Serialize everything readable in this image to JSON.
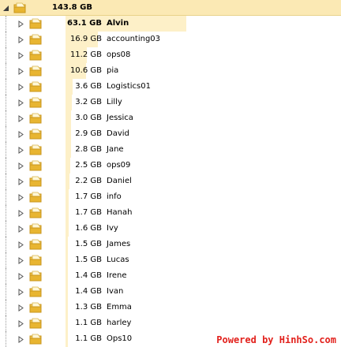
{
  "root": {
    "size": "143.8 GB"
  },
  "folders": [
    {
      "size": "63.1 GB",
      "name": "Alvin",
      "share": 0.439,
      "bold": true
    },
    {
      "size": "16.9 GB",
      "name": "accounting03",
      "share": 0.118,
      "bold": false
    },
    {
      "size": "11.2 GB",
      "name": "ops08",
      "share": 0.078,
      "bold": false
    },
    {
      "size": "10.6 GB",
      "name": "pia",
      "share": 0.074,
      "bold": false
    },
    {
      "size": "3.6 GB",
      "name": "Logistics01",
      "share": 0.025,
      "bold": false
    },
    {
      "size": "3.2 GB",
      "name": "Lilly",
      "share": 0.022,
      "bold": false
    },
    {
      "size": "3.0 GB",
      "name": "Jessica",
      "share": 0.021,
      "bold": false
    },
    {
      "size": "2.9 GB",
      "name": "David",
      "share": 0.02,
      "bold": false
    },
    {
      "size": "2.8 GB",
      "name": "Jane",
      "share": 0.019,
      "bold": false
    },
    {
      "size": "2.5 GB",
      "name": "ops09",
      "share": 0.017,
      "bold": false
    },
    {
      "size": "2.2 GB",
      "name": "Daniel",
      "share": 0.015,
      "bold": false
    },
    {
      "size": "1.7 GB",
      "name": "info",
      "share": 0.012,
      "bold": false
    },
    {
      "size": "1.7 GB",
      "name": "Hanah",
      "share": 0.012,
      "bold": false
    },
    {
      "size": "1.6 GB",
      "name": "Ivy",
      "share": 0.011,
      "bold": false
    },
    {
      "size": "1.5 GB",
      "name": "James",
      "share": 0.01,
      "bold": false
    },
    {
      "size": "1.5 GB",
      "name": "Lucas",
      "share": 0.01,
      "bold": false
    },
    {
      "size": "1.4 GB",
      "name": "Irene",
      "share": 0.01,
      "bold": false
    },
    {
      "size": "1.4 GB",
      "name": "Ivan",
      "share": 0.01,
      "bold": false
    },
    {
      "size": "1.3 GB",
      "name": "Emma",
      "share": 0.009,
      "bold": false
    },
    {
      "size": "1.1 GB",
      "name": "harley",
      "share": 0.008,
      "bold": false
    },
    {
      "size": "1.1 GB",
      "name": "Ops10",
      "share": 0.008,
      "bold": false
    }
  ],
  "icons": {
    "expand": "triangle-right-icon",
    "collapse": "triangle-down-icon",
    "folder": "folder-icon"
  },
  "colors": {
    "bar": "#fdf0c8",
    "root_bar": "#fbe9b4",
    "folder": "#e8b531",
    "watermark": "#e2211c"
  },
  "watermark": "Powered by HinhSo.com"
}
